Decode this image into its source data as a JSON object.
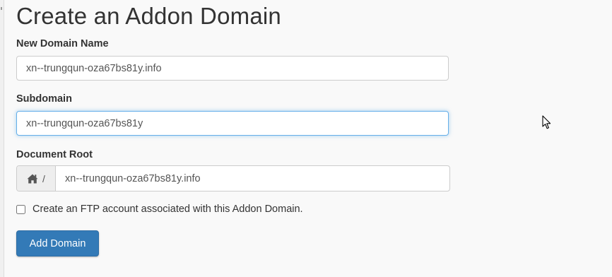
{
  "page": {
    "title": "Create an Addon Domain"
  },
  "form": {
    "new_domain": {
      "label": "New Domain Name",
      "value": "xn--trungqun-oza67bs81y.info"
    },
    "subdomain": {
      "label": "Subdomain",
      "value": "xn--trungqun-oza67bs81y"
    },
    "document_root": {
      "label": "Document Root",
      "prefix_icon": "home-icon",
      "prefix_text": "/",
      "value": "xn--trungqun-oza67bs81y.info"
    },
    "ftp_checkbox": {
      "label": "Create an FTP account associated with this Addon Domain.",
      "checked": false
    },
    "submit_label": "Add Domain"
  },
  "colors": {
    "primary": "#337ab7",
    "focus_border": "#66afe9",
    "background": "#f9f9f9"
  }
}
